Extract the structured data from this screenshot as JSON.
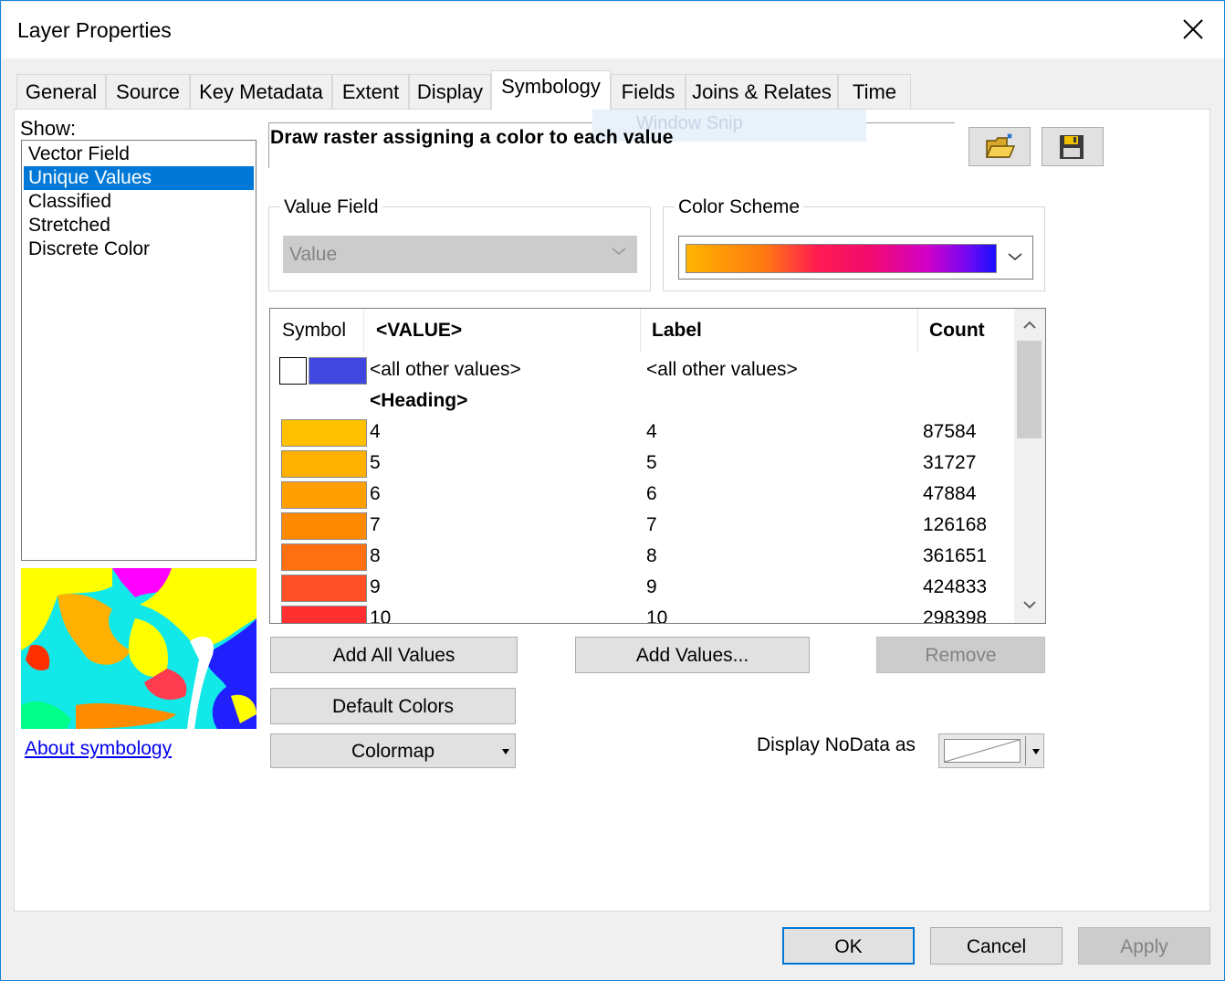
{
  "window": {
    "title": "Layer Properties"
  },
  "tabs": [
    {
      "label": "General"
    },
    {
      "label": "Source"
    },
    {
      "label": "Key Metadata"
    },
    {
      "label": "Extent"
    },
    {
      "label": "Display"
    },
    {
      "label": "Symbology",
      "active": true
    },
    {
      "label": "Fields"
    },
    {
      "label": "Joins & Relates"
    },
    {
      "label": "Time"
    }
  ],
  "show": {
    "label": "Show:",
    "items": [
      "Vector Field",
      "Unique Values",
      "Classified",
      "Stretched",
      "Discrete Color"
    ],
    "selected": "Unique Values",
    "about_link": "About symbology"
  },
  "renderer": {
    "description": "Draw raster assigning a color to each value",
    "overlay_text": "Window Snip",
    "open_button_icon": "folder-open-icon",
    "save_button_icon": "save-disk-icon"
  },
  "value_field": {
    "label": "Value Field",
    "value": "Value"
  },
  "color_scheme": {
    "label": "Color Scheme",
    "ramp_colors": [
      "#ffb400",
      "#ff7a10",
      "#ff1c50",
      "#f20a70",
      "#d000c8",
      "#7a08f0",
      "#1a10ff"
    ]
  },
  "table": {
    "headers": {
      "symbol": "Symbol",
      "value": "<VALUE>",
      "label": "Label",
      "count": "Count"
    },
    "other_row": {
      "value": "<all other values>",
      "label": "<all other values>",
      "color": "#4046e0"
    },
    "heading_row": {
      "value": "<Heading>"
    },
    "rows": [
      {
        "value": "4",
        "label": "4",
        "count": "87584",
        "color": "#ffc000"
      },
      {
        "value": "5",
        "label": "5",
        "count": "31727",
        "color": "#ffb000"
      },
      {
        "value": "6",
        "label": "6",
        "count": "47884",
        "color": "#ffa000"
      },
      {
        "value": "7",
        "label": "7",
        "count": "126168",
        "color": "#ff8a00"
      },
      {
        "value": "8",
        "label": "8",
        "count": "361651",
        "color": "#ff7010"
      },
      {
        "value": "9",
        "label": "9",
        "count": "424833",
        "color": "#ff5028"
      },
      {
        "value": "10",
        "label": "10",
        "count": "298398",
        "color": "#ff3030"
      }
    ]
  },
  "buttons": {
    "add_all_values": "Add All Values",
    "add_values": "Add Values...",
    "remove": "Remove",
    "default_colors": "Default Colors",
    "colormap": "Colormap"
  },
  "nodata": {
    "label": "Display NoData as"
  },
  "footer": {
    "ok": "OK",
    "cancel": "Cancel",
    "apply": "Apply"
  }
}
